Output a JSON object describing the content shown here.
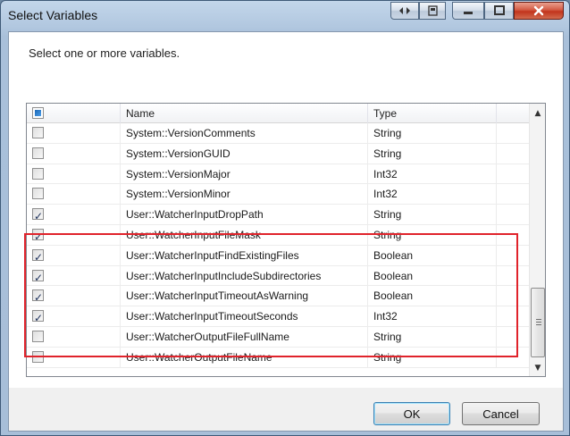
{
  "window": {
    "title": "Select Variables",
    "instruction": "Select one or more variables."
  },
  "titlebar_buttons": [
    "restore-icon",
    "pin-icon",
    "minimize-icon",
    "maximize-icon",
    "close-icon"
  ],
  "grid": {
    "columns": {
      "name": "Name",
      "type": "Type"
    },
    "rows": [
      {
        "checked": false,
        "name": "System::VersionComments",
        "type": "String"
      },
      {
        "checked": false,
        "name": "System::VersionGUID",
        "type": "String"
      },
      {
        "checked": false,
        "name": "System::VersionMajor",
        "type": "Int32"
      },
      {
        "checked": false,
        "name": "System::VersionMinor",
        "type": "Int32"
      },
      {
        "checked": true,
        "name": "User::WatcherInputDropPath",
        "type": "String"
      },
      {
        "checked": true,
        "name": "User::WatcherInputFileMask",
        "type": "String"
      },
      {
        "checked": true,
        "name": "User::WatcherInputFindExistingFiles",
        "type": "Boolean"
      },
      {
        "checked": true,
        "name": "User::WatcherInputIncludeSubdirectories",
        "type": "Boolean"
      },
      {
        "checked": true,
        "name": "User::WatcherInputTimeoutAsWarning",
        "type": "Boolean"
      },
      {
        "checked": true,
        "name": "User::WatcherInputTimeoutSeconds",
        "type": "Int32"
      },
      {
        "checked": false,
        "name": "User::WatcherOutputFileFullName",
        "type": "String"
      },
      {
        "checked": false,
        "name": "User::WatcherOutputFileName",
        "type": "String"
      }
    ]
  },
  "buttons": {
    "ok": "OK",
    "cancel": "Cancel"
  },
  "colors": {
    "highlight_box": "#e0232b",
    "window_frame": "#a9c0da",
    "close_button": "#c2341c"
  }
}
